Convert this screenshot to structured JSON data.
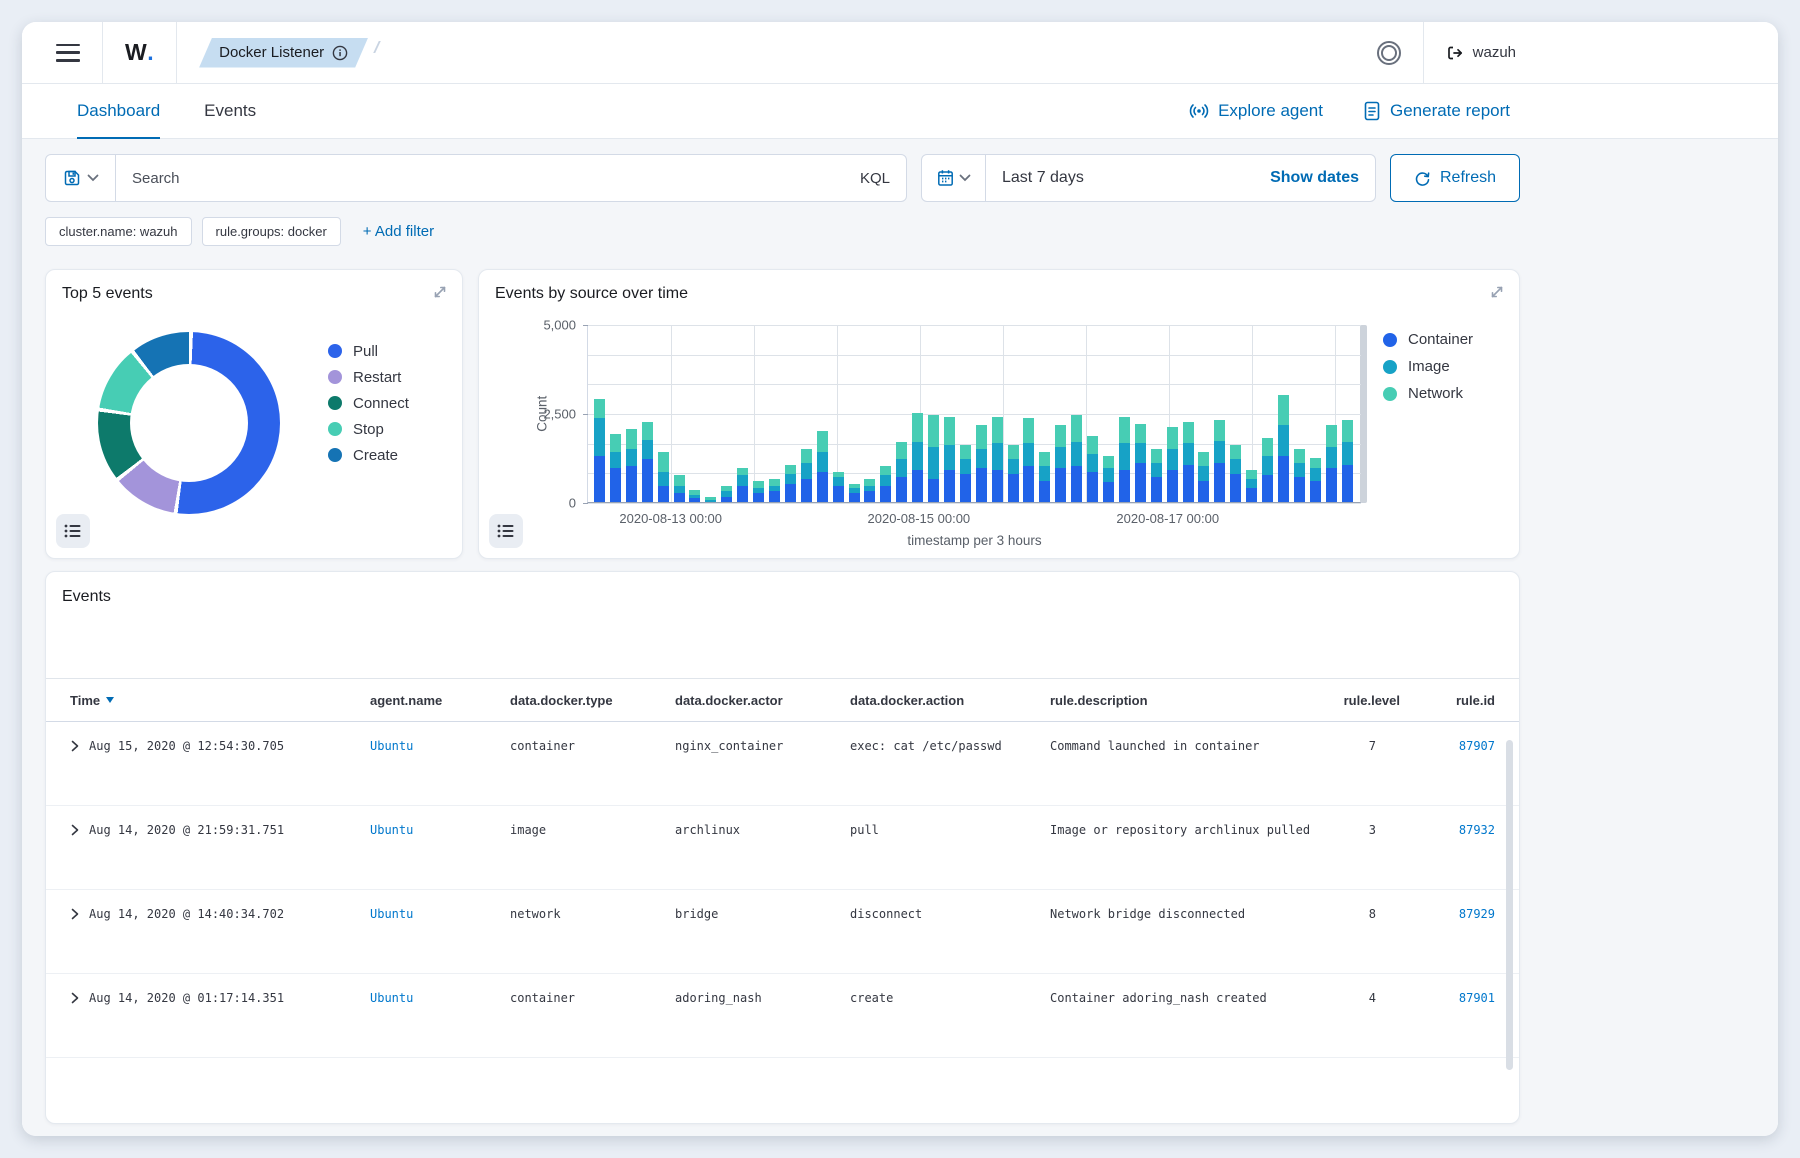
{
  "topbar": {
    "logo": "W",
    "logo_dot": ".",
    "breadcrumb": "Docker Listener",
    "user": "wazuh"
  },
  "tabs": {
    "items": [
      {
        "label": "Dashboard",
        "active": true
      },
      {
        "label": "Events",
        "active": false
      }
    ],
    "explore_label": "Explore agent",
    "report_label": "Generate report"
  },
  "search": {
    "placeholder": "Search",
    "kql_label": "KQL",
    "date_value": "Last 7 days",
    "show_dates_label": "Show dates",
    "refresh_label": "Refresh"
  },
  "filters": {
    "pills": [
      "cluster.name: wazuh",
      "rule.groups: docker"
    ],
    "add_label": "+ Add filter"
  },
  "icons": {
    "menu": "hamburger",
    "info": "circle-i",
    "news": "double-ring",
    "logout": "box-arrow-right",
    "explore": "antenna-waves",
    "report": "document-lines",
    "save-query": "floppy-disk",
    "chevron": "chevron-down",
    "calendar": "calendar",
    "refresh": "circular-arrow",
    "expand": "diagonal-arrows",
    "inspect": "bulleted-list",
    "row-expand": "chevron-right"
  },
  "chart_data": [
    {
      "type": "pie",
      "donut": true,
      "title": "Top 5 events",
      "labels": [
        "Pull",
        "Restart",
        "Connect",
        "Stop",
        "Create"
      ],
      "values_pct": [
        52,
        12,
        13,
        12,
        11
      ],
      "colors": [
        "#2c63ea",
        "#a394da",
        "#0d7a6b",
        "#47cdb4",
        "#1573b4"
      ],
      "legend_position": "right"
    },
    {
      "type": "bar",
      "stacked": true,
      "title": "Events by source over time",
      "xlabel": "timestamp per 3 hours",
      "ylabel": "Count",
      "ylim": [
        0,
        5000
      ],
      "yticks": [
        "0",
        "2,500",
        "5,000"
      ],
      "xticks": [
        "2020-08-13 00:00",
        "2020-08-15 00:00",
        "2020-08-17 00:00"
      ],
      "xtick_pos_pct": [
        10.7,
        42.8,
        75.0
      ],
      "legend_position": "right",
      "series": [
        {
          "name": "Container",
          "color": "#2163e8"
        },
        {
          "name": "Image",
          "color": "#17a2c6"
        },
        {
          "name": "Network",
          "color": "#47cdb4"
        }
      ],
      "bars": [
        [
          1300,
          1050,
          550
        ],
        [
          950,
          450,
          500
        ],
        [
          1000,
          500,
          550
        ],
        [
          1200,
          550,
          500
        ],
        [
          450,
          400,
          550
        ],
        [
          250,
          200,
          300
        ],
        [
          100,
          100,
          150
        ],
        [
          0,
          50,
          100
        ],
        [
          150,
          150,
          150
        ],
        [
          450,
          300,
          200
        ],
        [
          250,
          150,
          200
        ],
        [
          300,
          150,
          200
        ],
        [
          500,
          300,
          250
        ],
        [
          650,
          450,
          400
        ],
        [
          850,
          550,
          600
        ],
        [
          450,
          250,
          150
        ],
        [
          250,
          150,
          100
        ],
        [
          300,
          150,
          200
        ],
        [
          450,
          300,
          250
        ],
        [
          700,
          500,
          500
        ],
        [
          900,
          800,
          800
        ],
        [
          650,
          900,
          900
        ],
        [
          900,
          700,
          800
        ],
        [
          800,
          400,
          400
        ],
        [
          950,
          550,
          650
        ],
        [
          900,
          750,
          750
        ],
        [
          800,
          400,
          400
        ],
        [
          1000,
          650,
          700
        ],
        [
          600,
          400,
          400
        ],
        [
          950,
          600,
          600
        ],
        [
          1000,
          700,
          750
        ],
        [
          850,
          500,
          500
        ],
        [
          550,
          400,
          350
        ],
        [
          900,
          750,
          750
        ],
        [
          1100,
          550,
          550
        ],
        [
          700,
          400,
          400
        ],
        [
          900,
          600,
          600
        ],
        [
          1050,
          600,
          600
        ],
        [
          600,
          400,
          400
        ],
        [
          1100,
          600,
          600
        ],
        [
          800,
          400,
          400
        ],
        [
          400,
          250,
          250
        ],
        [
          750,
          550,
          500
        ],
        [
          1300,
          850,
          850
        ],
        [
          700,
          400,
          400
        ],
        [
          600,
          350,
          300
        ],
        [
          950,
          600,
          600
        ],
        [
          1050,
          650,
          600
        ]
      ]
    }
  ],
  "events_table": {
    "title": "Events",
    "columns": [
      {
        "key": "time",
        "label": "Time",
        "sortable": true
      },
      {
        "key": "agent",
        "label": "agent.name"
      },
      {
        "key": "type",
        "label": "data.docker.type"
      },
      {
        "key": "actor",
        "label": "data.docker.actor"
      },
      {
        "key": "action",
        "label": "data.docker.action"
      },
      {
        "key": "description",
        "label": "rule.description"
      },
      {
        "key": "level",
        "label": "rule.level",
        "align": "c"
      },
      {
        "key": "id",
        "label": "rule.id",
        "align": "r"
      }
    ],
    "rows": [
      {
        "time": "Aug 15, 2020 @ 12:54:30.705",
        "agent": "Ubuntu",
        "type": "container",
        "actor": "nginx_container",
        "action": "exec: cat /etc/passwd",
        "description": "Command launched in container",
        "level": "7",
        "id": "87907"
      },
      {
        "time": "Aug 14, 2020 @ 21:59:31.751",
        "agent": "Ubuntu",
        "type": "image",
        "actor": "archlinux",
        "action": "pull",
        "description": "Image or repository archlinux pulled",
        "level": "3",
        "id": "87932"
      },
      {
        "time": "Aug 14, 2020 @ 14:40:34.702",
        "agent": "Ubuntu",
        "type": "network",
        "actor": "bridge",
        "action": "disconnect",
        "description": "Network bridge disconnected",
        "level": "8",
        "id": "87929"
      },
      {
        "time": "Aug 14, 2020 @ 01:17:14.351",
        "agent": "Ubuntu",
        "type": "container",
        "actor": "adoring_nash",
        "action": "create",
        "description": "Container adoring_nash created",
        "level": "4",
        "id": "87901"
      }
    ]
  }
}
